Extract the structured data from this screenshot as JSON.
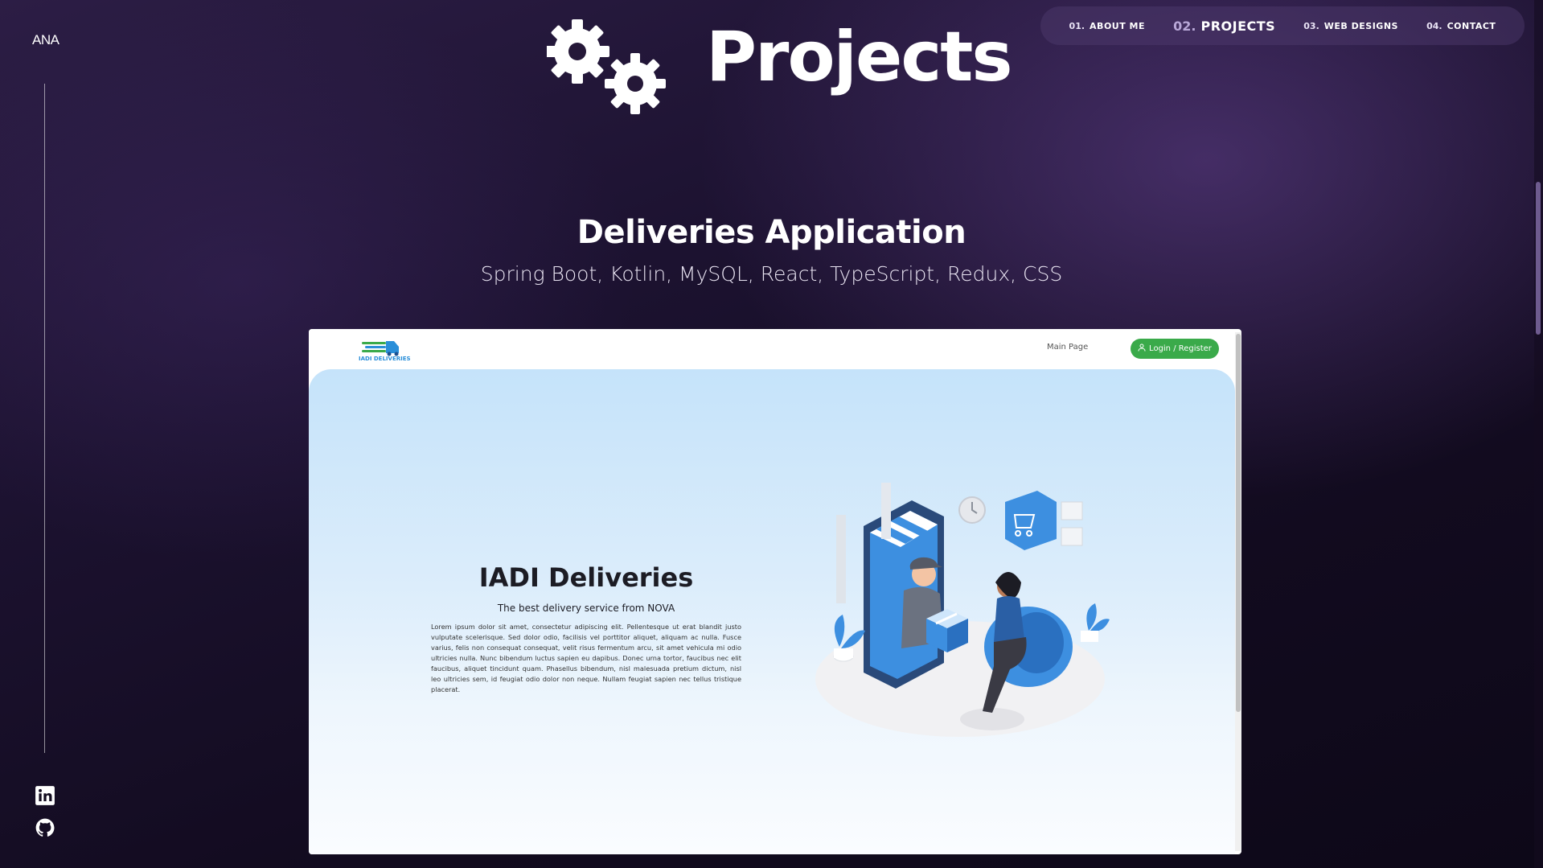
{
  "brand": {
    "logo_text": "ANA"
  },
  "nav": {
    "items": [
      {
        "num": "01.",
        "label": "ABOUT ME",
        "active": false
      },
      {
        "num": "02.",
        "label": "PROJECTS",
        "active": true
      },
      {
        "num": "03.",
        "label": "WEB DESIGNS",
        "active": false
      },
      {
        "num": "04.",
        "label": "CONTACT",
        "active": false
      }
    ]
  },
  "section": {
    "title": "Projects",
    "icon": "gears-icon"
  },
  "project": {
    "title": "Deliveries Application",
    "tech": "Spring Boot, Kotlin, MySQL, React, TypeScript, Redux, CSS"
  },
  "preview": {
    "logo_text": "IADI DELIVERIES",
    "main_link": "Main Page",
    "login_label": "Login / Register",
    "hero_title": "IADI Deliveries",
    "hero_subtitle": "The best delivery service from NOVA",
    "hero_body": "Lorem ipsum dolor sit amet, consectetur adipiscing elit. Pellentesque ut erat blandit justo vulputate scelerisque. Sed dolor odio, facilisis vel porttitor aliquet, aliquam ac nulla. Fusce varius, felis non consequat consequat, velit risus fermentum arcu, sit amet vehicula mi odio ultricies nulla. Nunc bibendum luctus sapien eu dapibus. Donec urna tortor, faucibus nec elit faucibus, aliquet tincidunt quam. Phasellus bibendum, nisl malesuada pretium dictum, nisl leo ultricies sem, id feugiat odio dolor non neque. Nullam feugiat sapien nec tellus tristique placerat."
  },
  "social": [
    {
      "name": "linkedin-icon"
    },
    {
      "name": "github-icon"
    }
  ],
  "colors": {
    "background": "#1c1230",
    "nav_active_num": "#b9a8d8",
    "login_button": "#3aaa4a",
    "accent_blue": "#3d8fe0"
  }
}
